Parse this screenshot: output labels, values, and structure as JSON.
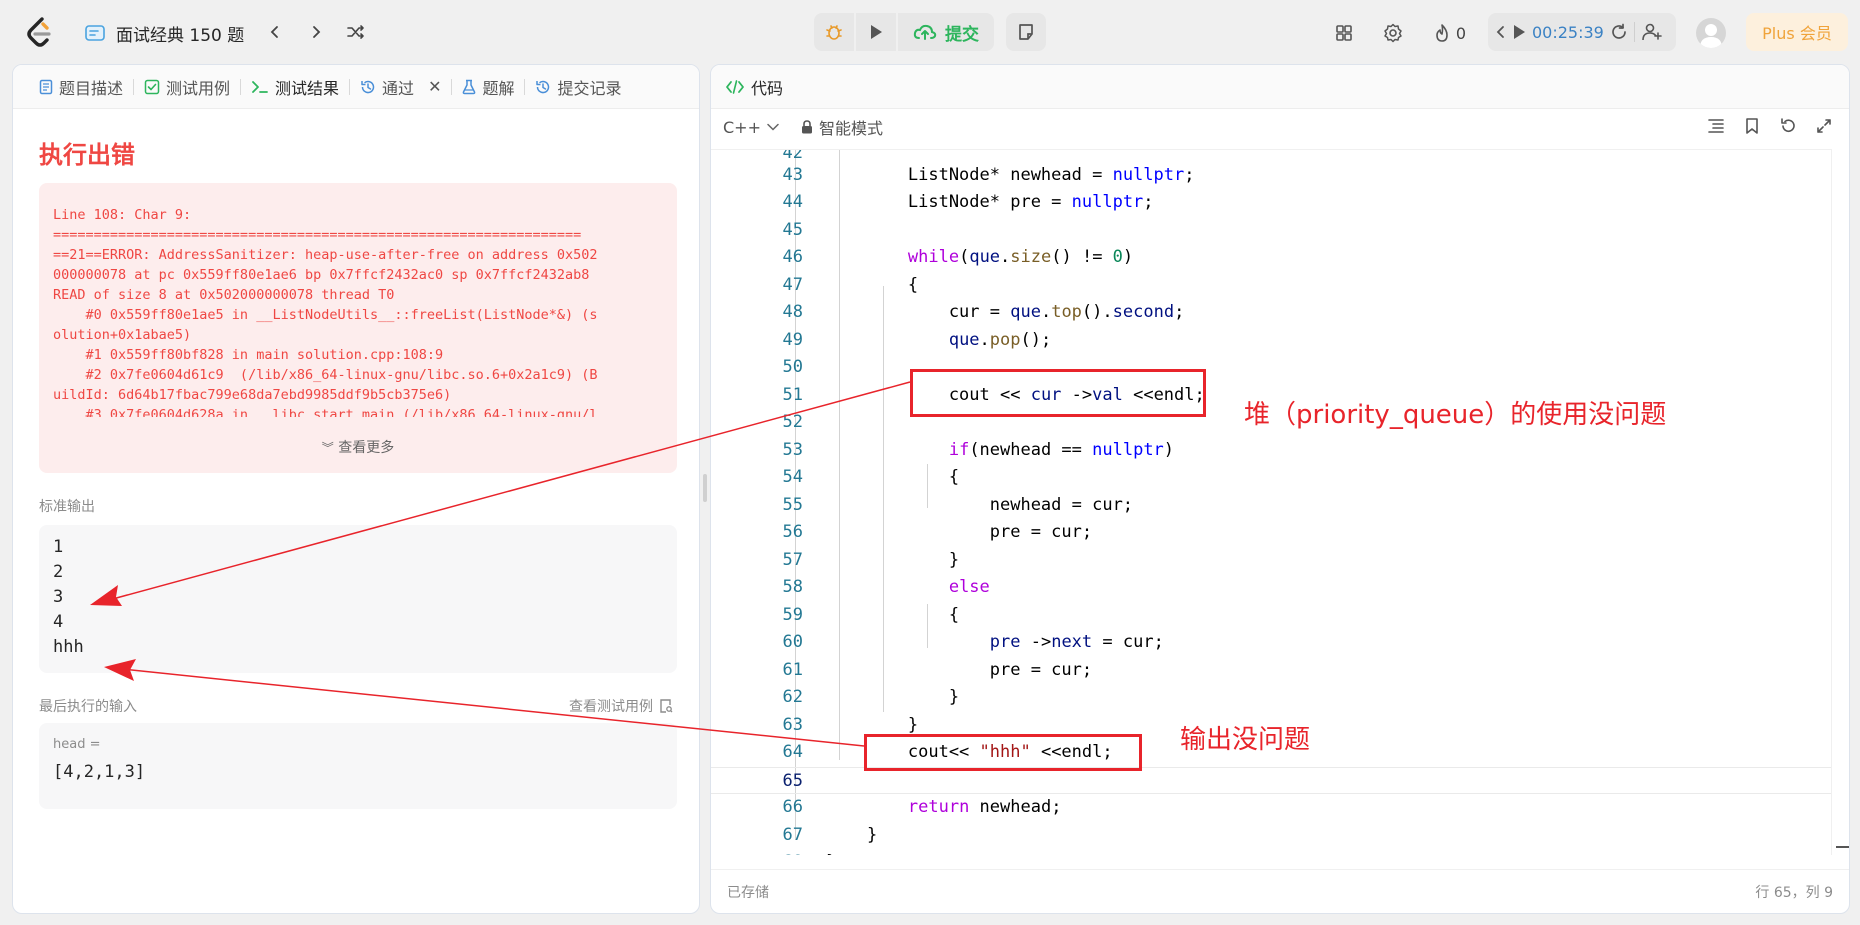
{
  "topbar": {
    "problem_list_title": "面试经典 150 题",
    "submit_label": "提交",
    "streak_count": "0",
    "timer": "00:25:39",
    "plus_label": "Plus 会员"
  },
  "left_tabs": [
    {
      "label": "题目描述",
      "icon": "doc-icon"
    },
    {
      "label": "测试用例",
      "icon": "checkbox-icon"
    },
    {
      "label": "测试结果",
      "icon": "terminal-icon"
    },
    {
      "label": "通过",
      "icon": "history-icon"
    },
    {
      "label": "题解",
      "icon": "flask-icon"
    },
    {
      "label": "提交记录",
      "icon": "history-icon"
    }
  ],
  "result": {
    "title": "执行出错",
    "error_lines": [
      "Line 108: Char 9:",
      "=================================================================",
      "==21==ERROR: AddressSanitizer: heap-use-after-free on address 0x502",
      "000000078 at pc 0x559ff80e1ae6 bp 0x7ffcf2432ac0 sp 0x7ffcf2432ab8",
      "READ of size 8 at 0x502000000078 thread T0",
      "    #0 0x559ff80e1ae5 in __ListNodeUtils__::freeList(ListNode*&) (s",
      "olution+0x1abae5)",
      "    #1 0x559ff80bf828 in main solution.cpp:108:9",
      "    #2 0x7fe0604d61c9  (/lib/x86_64-linux-gnu/libc.so.6+0x2a1c9) (B",
      "uildId: 6d64b17fbac799e68da7ebd9985ddf9b5cb375e6)",
      "    #3 0x7fe0604d628a in __libc_start_main (/lib/x86_64-linux-gnu/l"
    ],
    "see_more": "查看更多",
    "stdout_label": "标准输出",
    "stdout_lines": [
      "1",
      "2",
      "3",
      "4",
      "hhh"
    ],
    "last_input_label": "最后执行的输入",
    "view_cases": "查看测试用例",
    "input_name": "head =",
    "input_value": "[4,2,1,3]"
  },
  "editor": {
    "tab_label": "代码",
    "language": "C++",
    "mode": "智能模式",
    "status_saved": "已存储",
    "cursor_pos": "行 65，列 9"
  },
  "annotations": {
    "heap_note": "堆（priority_queue）的使用没问题",
    "output_note": "输出没问题"
  },
  "colors": {
    "error_red": "#ef4743",
    "annotation_red": "#e8242b",
    "submit_green": "#2db55d",
    "plus_orange": "#f0a33a"
  }
}
